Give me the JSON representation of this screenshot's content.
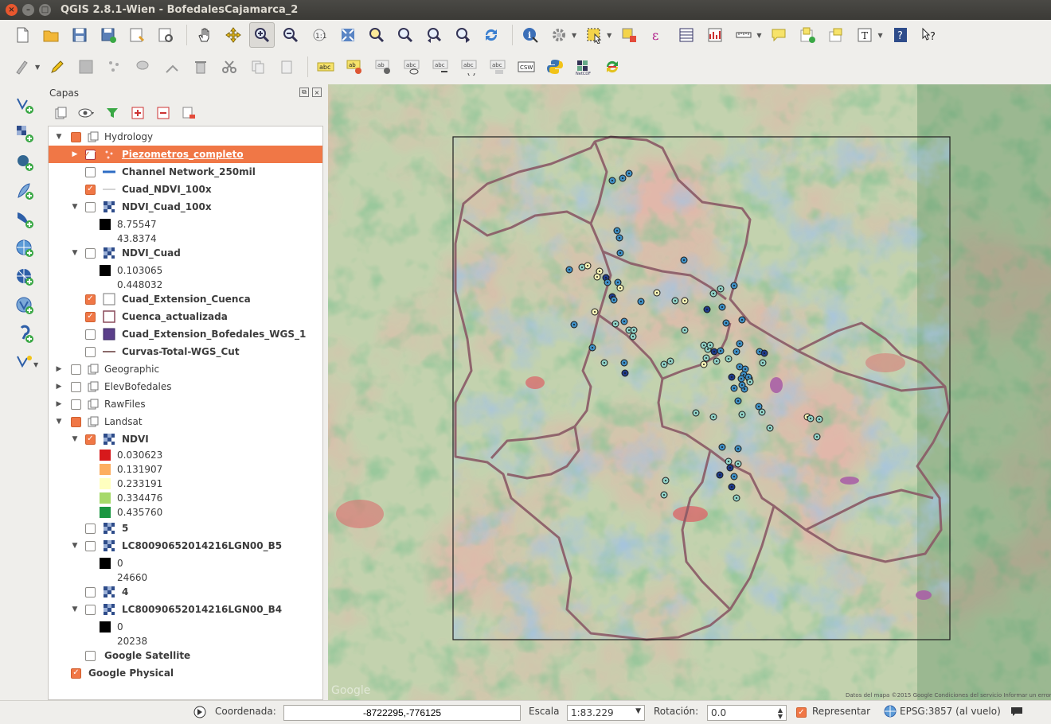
{
  "window": {
    "title": "QGIS 2.8.1-Wien - BofedalesCajamarca_2",
    "close_label": "×",
    "min_label": "–",
    "max_label": "□"
  },
  "panel": {
    "title": "Capas",
    "float_label": "⧉",
    "close_label": "×"
  },
  "tree": {
    "hydrology": "Hydrology",
    "piezometros": "Piezometros_completo",
    "channel": "Channel Network_250mil",
    "cuad_ndvi": "Cuad_NDVI_100x",
    "ndvi_cuad_100x": "NDVI_Cuad_100x",
    "ndvi_cuad_100x_min": "8.75547",
    "ndvi_cuad_100x_max": "43.8374",
    "ndvi_cuad": "NDVI_Cuad",
    "ndvi_cuad_min": "0.103065",
    "ndvi_cuad_max": "0.448032",
    "cuad_ext_cuenca": "Cuad_Extension_Cuenca",
    "cuenca_act": "Cuenca_actualizada",
    "cuad_ext_bof": "Cuad_Extension_Bofedales_WGS_1",
    "curvas": "Curvas-Total-WGS_Cut",
    "geographic": "Geographic",
    "elevbofedales": "ElevBofedales",
    "rawfiles": "RawFiles",
    "landsat": "Landsat",
    "ndvi": "NDVI",
    "ndvi_classes": [
      "0.030623",
      "0.131907",
      "0.233191",
      "0.334476",
      "0.435760"
    ],
    "ndvi_colors": [
      "#d7191c",
      "#fdae61",
      "#ffffbf",
      "#a6d96a",
      "#1a9641"
    ],
    "band5": "5",
    "lc_b5": "LC80090652014216LGN00_B5",
    "lc_b5_min": "0",
    "lc_b5_max": "24660",
    "band4": "4",
    "lc_b4": "LC80090652014216LGN00_B4",
    "lc_b4_min": "0",
    "lc_b4_max": "20238",
    "google_sat": "Google Satellite",
    "google_phys": "Google Physical"
  },
  "map": {
    "attribution": "Datos del mapa ©2015 Google   Condiciones del servicio   Informar un error en mapa",
    "google_logo": "Google"
  },
  "status": {
    "coord_label": "Coordenada:",
    "coord_value": "-8722295,-776125",
    "scale_label": "Escala",
    "scale_value": "1:83.229",
    "rotation_label": "Rotación:",
    "rotation_value": "0.0",
    "render_label": "Representar",
    "crs_label": "EPSG:3857 (al vuelo)"
  },
  "toolbar_icons": [
    "new-project",
    "open-project",
    "save-project",
    "save-as",
    "new-print-composer",
    "composer-manager",
    "pan",
    "pan-to-selection",
    "zoom-in",
    "zoom-out",
    "zoom-actual",
    "zoom-full",
    "zoom-selection",
    "zoom-layer",
    "zoom-last",
    "zoom-next",
    "refresh",
    "identify",
    "action",
    "select",
    "deselect",
    "field-calculator",
    "attribute-table",
    "statistics",
    "measure",
    "annotation",
    "new-bookmark",
    "show-bookmarks",
    "text-annotation",
    "help",
    "whats-this"
  ]
}
